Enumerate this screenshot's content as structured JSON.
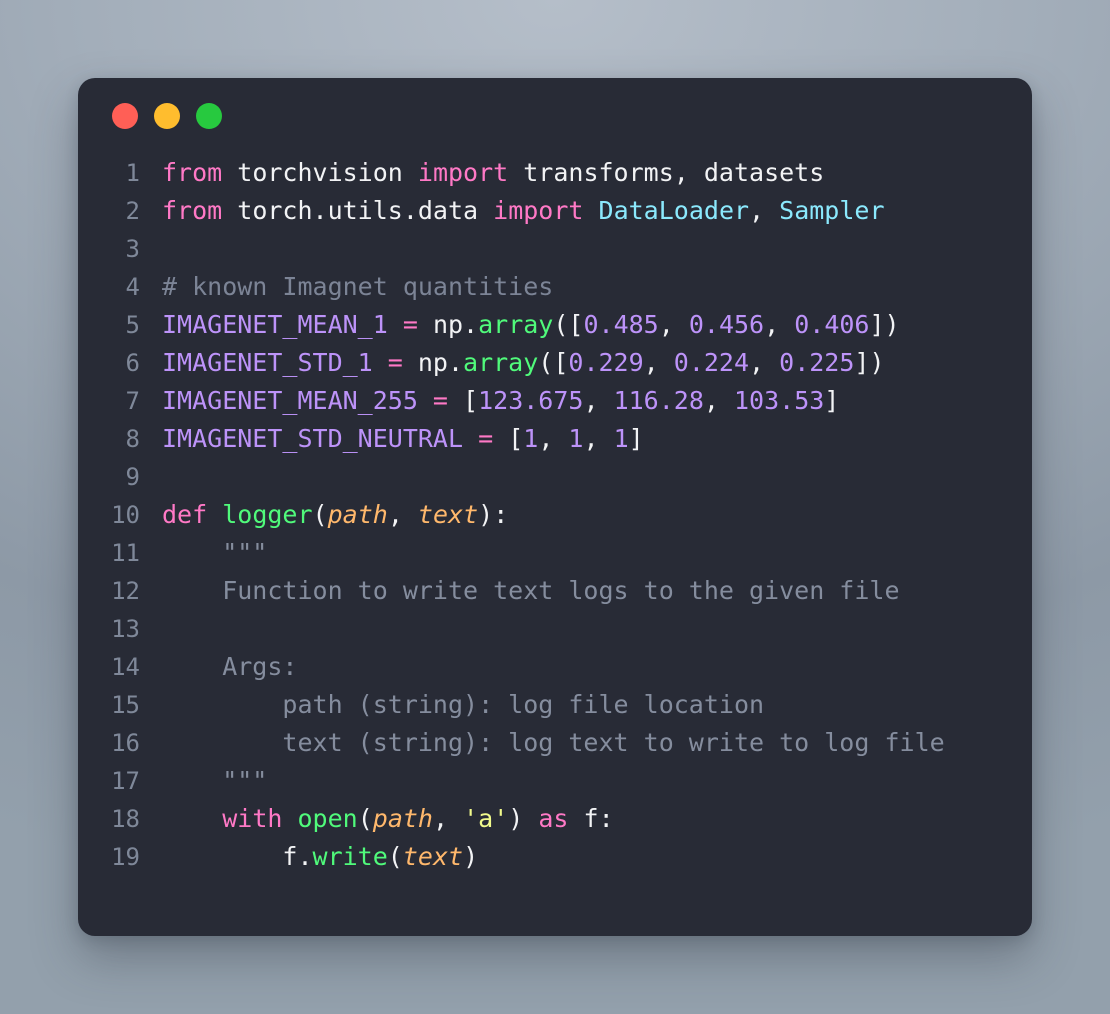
{
  "window": {
    "titlebar": {
      "close_label": "close",
      "minimize_label": "minimize",
      "maximize_label": "maximize"
    },
    "colors": {
      "background": "#282b36",
      "close": "#ff5f56",
      "minimize": "#ffbd2e",
      "maximize": "#27c93f",
      "keyword": "#ff79c6",
      "function": "#50fa7b",
      "class": "#8be9fd",
      "variable": "#bd93f9",
      "number": "#bd93f9",
      "parameter": "#ffb86c",
      "string": "#f1fa8c",
      "comment": "#7c8496",
      "plain": "#f2f3f5",
      "line_number": "#7f8899"
    }
  },
  "code": {
    "language": "python",
    "line_numbers": [
      "1",
      "2",
      "3",
      "4",
      "5",
      "6",
      "7",
      "8",
      "9",
      "10",
      "11",
      "12",
      "13",
      "14",
      "15",
      "16",
      "17",
      "18",
      "19"
    ],
    "lines": [
      {
        "n": "1",
        "text": "from torchvision import transforms, datasets"
      },
      {
        "n": "2",
        "text": "from torch.utils.data import DataLoader, Sampler"
      },
      {
        "n": "3",
        "text": ""
      },
      {
        "n": "4",
        "text": "# known Imagnet quantities"
      },
      {
        "n": "5",
        "text": "IMAGENET_MEAN_1 = np.array([0.485, 0.456, 0.406])"
      },
      {
        "n": "6",
        "text": "IMAGENET_STD_1 = np.array([0.229, 0.224, 0.225])"
      },
      {
        "n": "7",
        "text": "IMAGENET_MEAN_255 = [123.675, 116.28, 103.53]"
      },
      {
        "n": "8",
        "text": "IMAGENET_STD_NEUTRAL = [1, 1, 1]"
      },
      {
        "n": "9",
        "text": ""
      },
      {
        "n": "10",
        "text": "def logger(path, text):"
      },
      {
        "n": "11",
        "text": "    \"\"\""
      },
      {
        "n": "12",
        "text": "    Function to write text logs to the given file"
      },
      {
        "n": "13",
        "text": ""
      },
      {
        "n": "14",
        "text": "    Args:"
      },
      {
        "n": "15",
        "text": "        path (string): log file location"
      },
      {
        "n": "16",
        "text": "        text (string): log text to write to log file"
      },
      {
        "n": "17",
        "text": "    \"\"\""
      },
      {
        "n": "18",
        "text": "    with open(path, 'a') as f:"
      },
      {
        "n": "19",
        "text": "        f.write(text)"
      }
    ],
    "tokens": {
      "l1_from": "from",
      "l1_mod": " torchvision ",
      "l1_import": "import",
      "l1_names": " transforms, datasets",
      "l2_from": "from",
      "l2_mod": " torch.utils.data ",
      "l2_import": "import",
      "l2_sp": " ",
      "l2_cls1": "DataLoader",
      "l2_comma": ", ",
      "l2_cls2": "Sampler",
      "l4_comment": "# known Imagnet quantities",
      "l5_var": "IMAGENET_MEAN_1",
      "l5_eq": " = ",
      "l5_np": "np.",
      "l5_array": "array",
      "l5_open": "([",
      "l5_n1": "0.485",
      "l5_c1": ", ",
      "l5_n2": "0.456",
      "l5_c2": ", ",
      "l5_n3": "0.406",
      "l5_close": "])",
      "l6_var": "IMAGENET_STD_1",
      "l6_eq": " = ",
      "l6_np": "np.",
      "l6_array": "array",
      "l6_open": "([",
      "l6_n1": "0.229",
      "l6_c1": ", ",
      "l6_n2": "0.224",
      "l6_c2": ", ",
      "l6_n3": "0.225",
      "l6_close": "])",
      "l7_var": "IMAGENET_MEAN_255",
      "l7_eq": " = ",
      "l7_open": "[",
      "l7_n1": "123.675",
      "l7_c1": ", ",
      "l7_n2": "116.28",
      "l7_c2": ", ",
      "l7_n3": "103.53",
      "l7_close": "]",
      "l8_var": "IMAGENET_STD_NEUTRAL",
      "l8_eq": " = ",
      "l8_open": "[",
      "l8_n1": "1",
      "l8_c1": ", ",
      "l8_n2": "1",
      "l8_c2": ", ",
      "l8_n3": "1",
      "l8_close": "]",
      "l10_def": "def",
      "l10_sp": " ",
      "l10_fn": "logger",
      "l10_open": "(",
      "l10_p1": "path",
      "l10_comma": ", ",
      "l10_p2": "text",
      "l10_close": "):",
      "l11_doc": "    \"\"\"",
      "l12_doc": "    Function to write text logs to the given file",
      "l14_doc": "    Args:",
      "l15_doc": "        path (string): log file location",
      "l16_doc": "        text (string): log text to write to log file",
      "l17_doc": "    \"\"\"",
      "l18_ind": "    ",
      "l18_with": "with",
      "l18_sp": " ",
      "l18_open_fn": "open",
      "l18_paren": "(",
      "l18_p1": "path",
      "l18_comma": ", ",
      "l18_str": "'a'",
      "l18_rparen": ") ",
      "l18_as": "as",
      "l18_f": " f:",
      "l19_ind": "        ",
      "l19_f": "f.",
      "l19_write": "write",
      "l19_open": "(",
      "l19_p": "text",
      "l19_close": ")"
    }
  }
}
